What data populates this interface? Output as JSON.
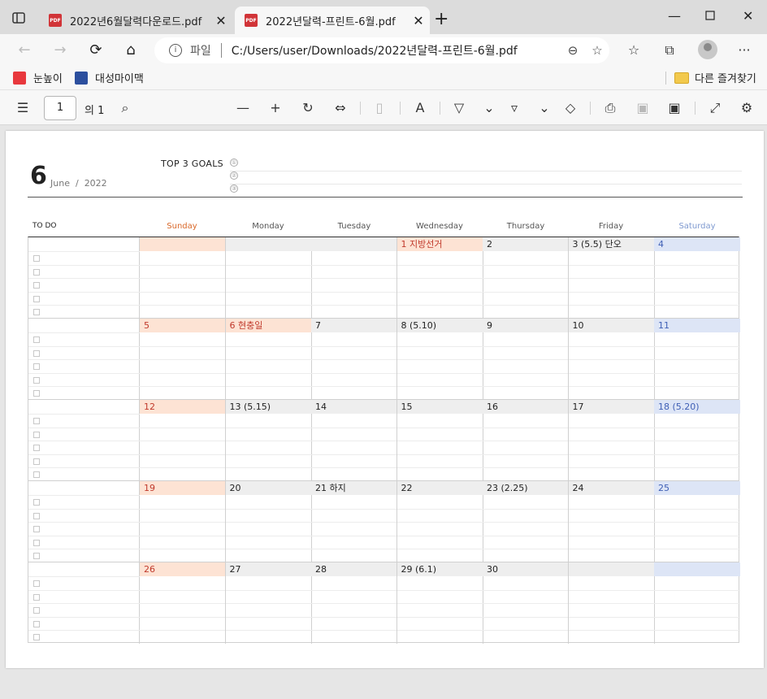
{
  "browser": {
    "tabs": [
      {
        "title": "2022년6월달력다운로드.pdf",
        "icon": "pdf-icon",
        "active": false
      },
      {
        "title": "2022년달력-프린트-6월.pdf",
        "icon": "pdf-icon",
        "active": true
      }
    ],
    "address": {
      "scheme": "파일",
      "url": "C:/Users/user/Downloads/2022년달력-프린트-6월.pdf"
    },
    "favorites": [
      {
        "label": "눈높이",
        "color": "#e8383d"
      },
      {
        "label": "대성마이맥",
        "color": "#2c4f9e"
      }
    ],
    "favorites_folder": "다른 즐겨찾기"
  },
  "pdf_toolbar": {
    "page_current": "1",
    "page_total": "의 1"
  },
  "calendar": {
    "month_number": "6",
    "month_name": "June",
    "year_sep": "/",
    "year": "2022",
    "goals_title": "TOP 3 GOALS",
    "goal_marks": [
      "①",
      "②",
      "③"
    ],
    "todo_label": "TO DO",
    "days_of_week": [
      "Sunday",
      "Monday",
      "Tuesday",
      "Wednesday",
      "Thursday",
      "Friday",
      "Saturday"
    ],
    "dow_colors": {
      "sunday": "#d9682a",
      "saturday": "#7f9ad0",
      "weekday": "#555555"
    },
    "weeks": [
      [
        "",
        "",
        "",
        "1  지방선거",
        "2",
        "3  (5.5)  단오",
        "4"
      ],
      [
        "5",
        "6  현충일",
        "7",
        "8  (5.10)",
        "9",
        "10",
        "11"
      ],
      [
        "12",
        "13  (5.15)",
        "14",
        "15",
        "16",
        "17",
        "18  (5.20)"
      ],
      [
        "19",
        "20",
        "21  하지",
        "22",
        "23  (2.25)",
        "24",
        "25"
      ],
      [
        "26",
        "27",
        "28",
        "29  (6.1)",
        "30",
        "",
        ""
      ]
    ],
    "holidays": [
      [
        0,
        3
      ],
      [
        1,
        1
      ]
    ],
    "colors": {
      "holiday_bg": "#fde3d4",
      "holiday_text": "#c0392b",
      "saturday_bg": "#dde5f6",
      "saturday_text": "#3f5fb5"
    }
  }
}
